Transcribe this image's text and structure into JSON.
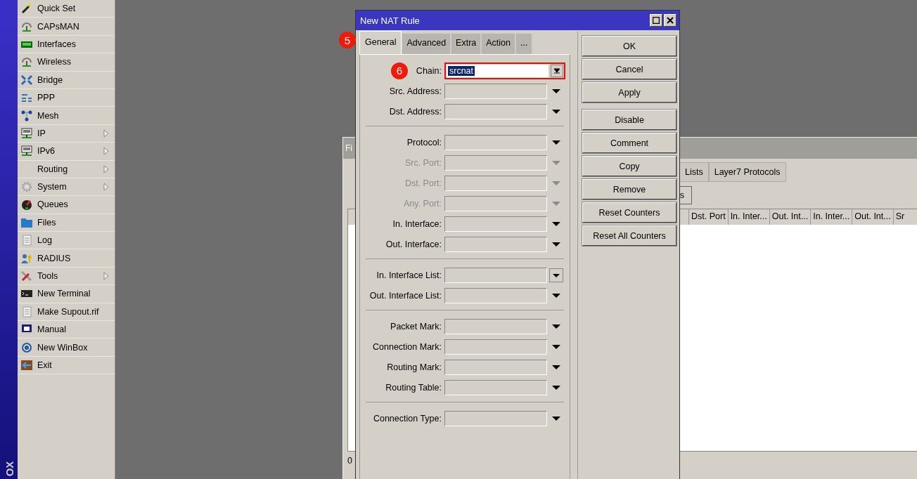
{
  "sidebar": {
    "brand": "OX",
    "items": [
      {
        "label": "Quick Set",
        "submenu": false
      },
      {
        "label": "CAPsMAN",
        "submenu": false
      },
      {
        "label": "Interfaces",
        "submenu": false
      },
      {
        "label": "Wireless",
        "submenu": false
      },
      {
        "label": "Bridge",
        "submenu": false
      },
      {
        "label": "PPP",
        "submenu": false
      },
      {
        "label": "Mesh",
        "submenu": false
      },
      {
        "label": "IP",
        "submenu": true
      },
      {
        "label": "IPv6",
        "submenu": true
      },
      {
        "label": "Routing",
        "submenu": true
      },
      {
        "label": "System",
        "submenu": true
      },
      {
        "label": "Queues",
        "submenu": false
      },
      {
        "label": "Files",
        "submenu": false
      },
      {
        "label": "Log",
        "submenu": false
      },
      {
        "label": "RADIUS",
        "submenu": false
      },
      {
        "label": "Tools",
        "submenu": true
      },
      {
        "label": "New Terminal",
        "submenu": false
      },
      {
        "label": "Make Supout.rif",
        "submenu": false
      },
      {
        "label": "Manual",
        "submenu": false
      },
      {
        "label": "New WinBox",
        "submenu": false
      },
      {
        "label": "Exit",
        "submenu": false
      }
    ]
  },
  "background_window": {
    "title": "Fi",
    "tabs": [
      {
        "label": "Lists",
        "selected": false
      },
      {
        "label": "Layer7 Protocols",
        "selected": false
      }
    ],
    "toolbar_button": "s",
    "columns": [
      "Dst. Port",
      "In. Inter...",
      "Out. Int...",
      "In. Inter...",
      "Out. Int...",
      "Sr"
    ],
    "status": "0"
  },
  "dialog": {
    "title": "New NAT Rule",
    "tabs": [
      {
        "label": "General",
        "selected": true,
        "badge": "5"
      },
      {
        "label": "Advanced",
        "selected": false
      },
      {
        "label": "Extra",
        "selected": false
      },
      {
        "label": "Action",
        "selected": false
      },
      {
        "label": "...",
        "selected": false
      }
    ],
    "field_groups": [
      [
        {
          "label": "Chain:",
          "value": "srcnat",
          "kind": "combo",
          "disabled": false,
          "highlighted": true,
          "badge": "6"
        },
        {
          "label": "Src. Address:",
          "kind": "dropdown",
          "disabled": false
        },
        {
          "label": "Dst. Address:",
          "kind": "dropdown",
          "disabled": false
        }
      ],
      [
        {
          "label": "Protocol:",
          "kind": "dropdown",
          "disabled": false
        },
        {
          "label": "Src. Port:",
          "kind": "dropdown",
          "disabled": true
        },
        {
          "label": "Dst. Port:",
          "kind": "dropdown",
          "disabled": true
        },
        {
          "label": "Any. Port:",
          "kind": "dropdown",
          "disabled": true
        },
        {
          "label": "In. Interface:",
          "kind": "dropdown",
          "disabled": false
        },
        {
          "label": "Out. Interface:",
          "kind": "dropdown",
          "disabled": false
        }
      ],
      [
        {
          "label": "In. Interface List:",
          "kind": "boxed",
          "disabled": false
        },
        {
          "label": "Out. Interface List:",
          "kind": "dropdown",
          "disabled": false
        }
      ],
      [
        {
          "label": "Packet Mark:",
          "kind": "dropdown",
          "disabled": false
        },
        {
          "label": "Connection Mark:",
          "kind": "dropdown",
          "disabled": false
        },
        {
          "label": "Routing Mark:",
          "kind": "dropdown",
          "disabled": false
        },
        {
          "label": "Routing Table:",
          "kind": "dropdown",
          "disabled": false
        }
      ],
      [
        {
          "label": "Connection Type:",
          "kind": "dropdown",
          "disabled": false
        }
      ]
    ],
    "button_groups": [
      [
        "OK",
        "Cancel",
        "Apply"
      ],
      [
        "Disable",
        "Comment",
        "Copy",
        "Remove",
        "Reset Counters",
        "Reset All Counters"
      ]
    ]
  }
}
